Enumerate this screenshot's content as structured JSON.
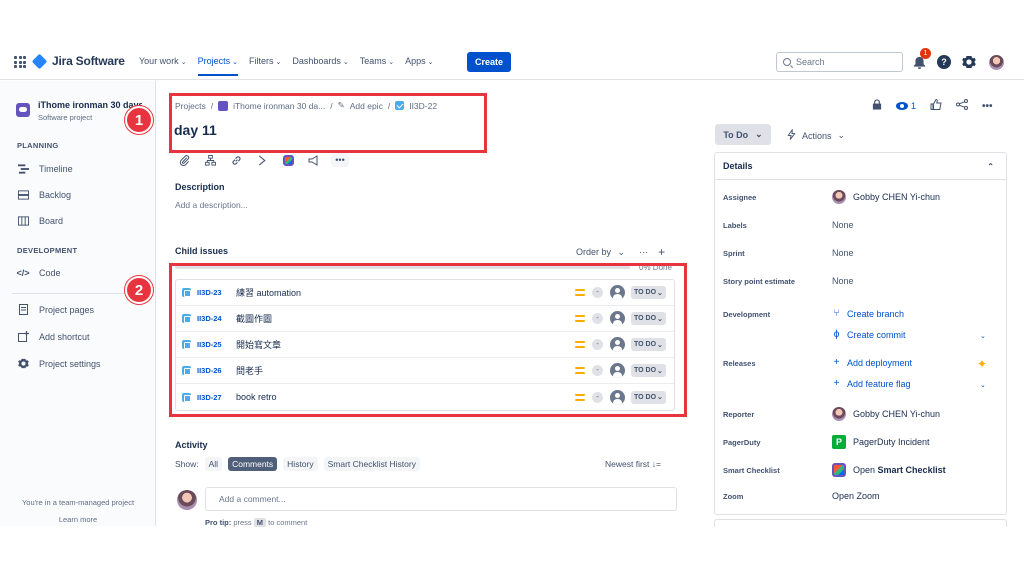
{
  "nav": {
    "logo_text": "Jira Software",
    "menu": [
      {
        "label": "Your work"
      },
      {
        "label": "Projects"
      },
      {
        "label": "Filters"
      },
      {
        "label": "Dashboards"
      },
      {
        "label": "Teams"
      },
      {
        "label": "Apps"
      }
    ],
    "create_label": "Create",
    "search_placeholder": "Search",
    "notification_count": "1"
  },
  "sidebar": {
    "project_name": "iThome ironman 30 days",
    "project_type": "Software project",
    "planning_title": "PLANNING",
    "planning_items": [
      {
        "label": "Timeline"
      },
      {
        "label": "Backlog"
      },
      {
        "label": "Board"
      }
    ],
    "development_title": "DEVELOPMENT",
    "development_items": [
      {
        "label": "Code"
      }
    ],
    "other_items": [
      {
        "label": "Project pages"
      },
      {
        "label": "Add shortcut"
      },
      {
        "label": "Project settings"
      }
    ],
    "footer_text": "You're in a team-managed project",
    "learn_more": "Learn more"
  },
  "issue": {
    "breadcrumb": {
      "projects": "Projects",
      "project": "iThome ironman 30 da...",
      "add_epic": "Add epic",
      "key": "II3D-22"
    },
    "title": "day 11",
    "description_label": "Description",
    "description_placeholder": "Add a description...",
    "child_issues_label": "Child issues",
    "order_by": "Order by",
    "progress_text": "0% Done",
    "progress_fraction": 0,
    "child_issues": [
      {
        "key": "II3D-23",
        "summary": "練習 automation",
        "priority": "-",
        "status": "TO DO"
      },
      {
        "key": "II3D-24",
        "summary": "截圖作圖",
        "priority": "-",
        "status": "TO DO"
      },
      {
        "key": "II3D-25",
        "summary": "開始寫文章",
        "priority": "-",
        "status": "TO DO"
      },
      {
        "key": "II3D-26",
        "summary": "問老手",
        "priority": "-",
        "status": "TO DO"
      },
      {
        "key": "II3D-27",
        "summary": "book retro",
        "priority": "-",
        "status": "TO DO"
      }
    ],
    "activity_label": "Activity",
    "show_label": "Show:",
    "activity_tabs": [
      {
        "label": "All"
      },
      {
        "label": "Comments"
      },
      {
        "label": "History"
      },
      {
        "label": "Smart Checklist History"
      }
    ],
    "sort_label": "Newest first",
    "comment_placeholder": "Add a comment...",
    "pro_tip_label": "Pro tip:",
    "pro_tip_press": "press",
    "pro_tip_key": "M",
    "pro_tip_rest": "to comment"
  },
  "annotations": [
    {
      "number": "1"
    },
    {
      "number": "2"
    }
  ],
  "details": {
    "watch_count": "1",
    "status_button": "To Do",
    "actions_label": "Actions",
    "heading": "Details",
    "assignee_label": "Assignee",
    "assignee": "Gobby CHEN Yi-chun",
    "labels_label": "Labels",
    "labels": "None",
    "sprint_label": "Sprint",
    "sprint": "None",
    "story_points_label": "Story point estimate",
    "story_points": "None",
    "development_label": "Development",
    "create_branch": "Create branch",
    "create_commit": "Create commit",
    "releases_label": "Releases",
    "add_deployment": "Add deployment",
    "add_feature_flag": "Add feature flag",
    "reporter_label": "Reporter",
    "reporter": "Gobby CHEN Yi-chun",
    "pagerduty_label": "PagerDuty",
    "pagerduty": "PagerDuty Incident",
    "smart_checklist_label": "Smart Checklist",
    "smart_checklist_open": "Open",
    "smart_checklist_bold": "Smart Checklist",
    "zoom_label": "Zoom",
    "zoom": "Open Zoom"
  },
  "colors": {
    "accent": "#0052cc",
    "annotation": "#e8343e",
    "priority_medium": "#ffab00"
  }
}
